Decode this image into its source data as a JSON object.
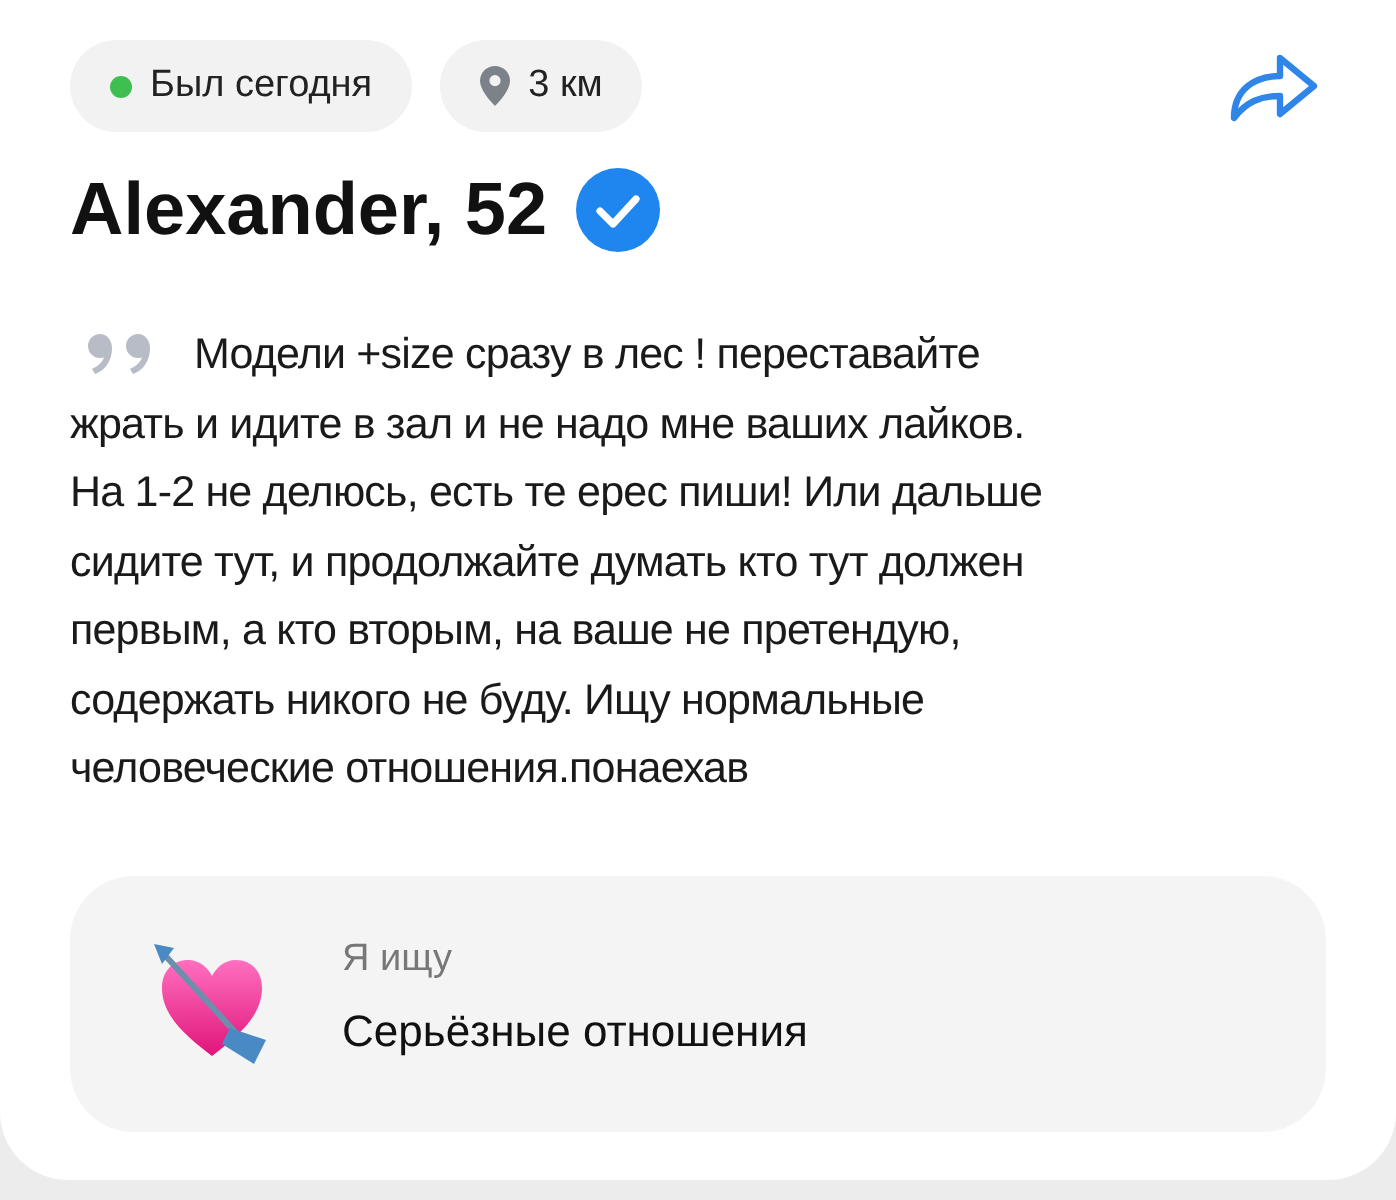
{
  "status_chips": [
    {
      "kind": "online",
      "label": "Был сегодня",
      "online": true
    },
    {
      "kind": "distance",
      "label": "3 км"
    }
  ],
  "profile": {
    "name": "Alexander, 52",
    "verified": true
  },
  "about_lines": [
    "Модели +size сразу в лес ! переставайте",
    "жрать и идите в зал и не надо мне ваших лайков.",
    "На 1-2 не делюсь, есть те ерес пиши! Или дальше",
    "сидите тут, и продолжайте думать кто тут должен",
    "первым, а кто вторым, на ваше не претендую,",
    "содержать никого не буду. Ищу нормальные",
    "человеческие отношения.понаехав"
  ],
  "looking_for": {
    "label": "Я ищу",
    "value": "Серьёзные отношения"
  }
}
